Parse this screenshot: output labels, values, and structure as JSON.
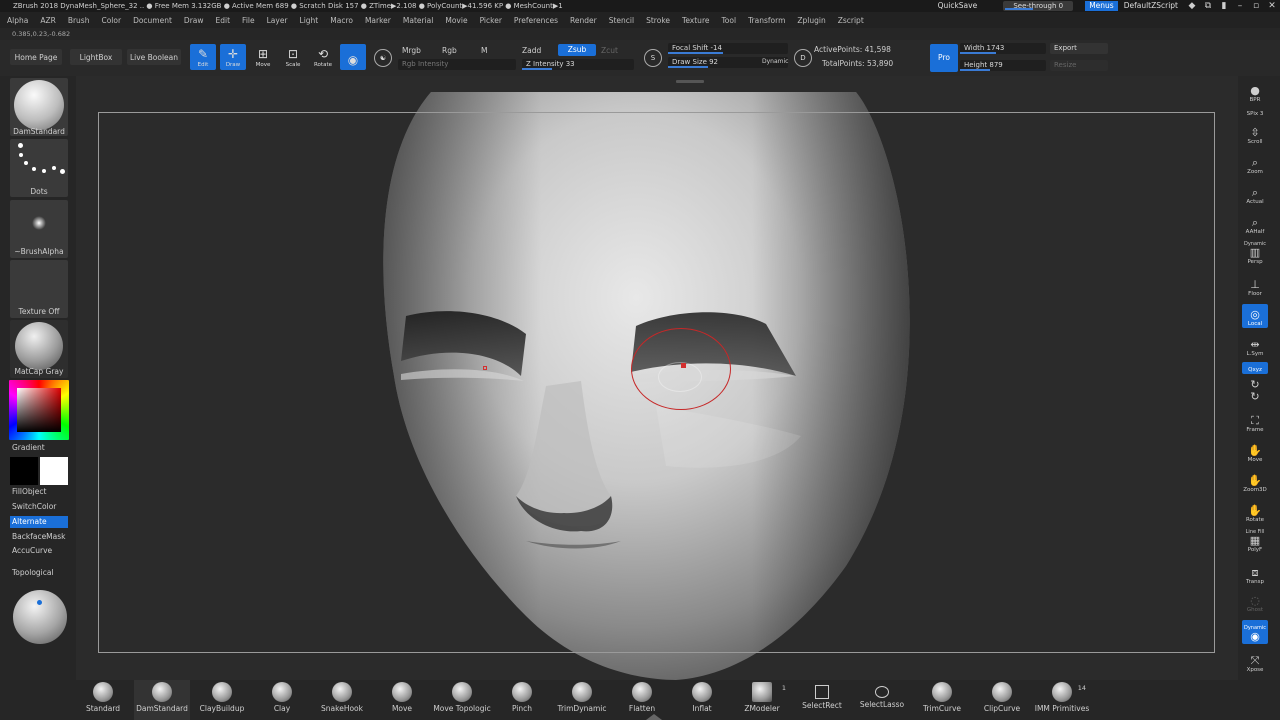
{
  "titlebar": {
    "title": "ZBrush 2018   DynaMesh_Sphere_32    ..  ● Free Mem 3.132GB ● Active Mem 689 ● Scratch Disk 157 ●  ZTime▶2.108 ● PolyCount▶41.596 KP ● MeshCount▶1",
    "quicksave": "QuickSave",
    "seethrough": "See-through  0",
    "menus": "Menus",
    "script": "DefaultZScript"
  },
  "menubar": [
    "Alpha",
    "AZR",
    "Brush",
    "Color",
    "Document",
    "Draw",
    "Edit",
    "File",
    "Layer",
    "Light",
    "Macro",
    "Marker",
    "Material",
    "Movie",
    "Picker",
    "Preferences",
    "Render",
    "Stencil",
    "Stroke",
    "Texture",
    "Tool",
    "Transform",
    "Zplugin",
    "Zscript"
  ],
  "coords": "0.385,0.23,-0.682",
  "shelf": {
    "home_page": "Home Page",
    "lightbox": "LightBox",
    "live_boolean": "Live Boolean",
    "modes": {
      "edit": "Edit",
      "draw": "Draw",
      "move": "Move",
      "scale": "Scale",
      "rotate": "Rotate"
    },
    "mrgb": "Mrgb",
    "rgb": "Rgb",
    "m": "M",
    "rgb_intensity": "Rgb Intensity",
    "zadd": "Zadd",
    "zsub": "Zsub",
    "zcut": "Zcut",
    "z_intensity": "Z Intensity 33",
    "focal_shift": "Focal Shift -14",
    "draw_size": "Draw Size 92",
    "dynamic": "Dynamic",
    "active_points": "ActivePoints: 41,598",
    "total_points": "TotalPoints: 53,890",
    "pro": "Pro",
    "width": "Width 1743",
    "height": "Height 879",
    "export": "Export",
    "resize": "Resize"
  },
  "left": {
    "brush": "DamStandard",
    "stroke": "Dots",
    "alpha": "~BrushAlpha",
    "texture": "Texture Off",
    "material": "MatCap Gray",
    "gradient": "Gradient",
    "fill_object": "FillObject",
    "switch_color": "SwitchColor",
    "alternate": "Alternate",
    "backface": "BackfaceMask",
    "accucurve": "AccuCurve",
    "topological": "Topological"
  },
  "right": {
    "bpr": "BPR",
    "spix": "SPix 3",
    "scroll": "Scroll",
    "zoom": "Zoom",
    "actual": "Actual",
    "aahalf": "AAHalf",
    "dynamic": "Dynamic",
    "persp": "Persp",
    "floor": "Floor",
    "local": "Local",
    "lsym": "L.Sym",
    "xyz": "Qxyz",
    "frame": "Frame",
    "move": "Move",
    "zoom3d": "Zoom3D",
    "rotate": "Rotate",
    "linefill": "Line Fill",
    "polyf": "PolyF",
    "transp": "Transp",
    "ghost": "Ghost",
    "solo": "Dynamic",
    "xpose": "Xpose"
  },
  "bottom": [
    "Standard",
    "DamStandard",
    "ClayBuildup",
    "Clay",
    "SnakeHook",
    "Move",
    "Move Topologic",
    "Pinch",
    "TrimDynamic",
    "Flatten",
    "Inflat",
    "ZModeler",
    "SelectRect",
    "SelectLasso",
    "TrimCurve",
    "ClipCurve",
    "IMM Primitives"
  ],
  "bottom_badges": {
    "zmodeler": "1",
    "imm": "14"
  }
}
